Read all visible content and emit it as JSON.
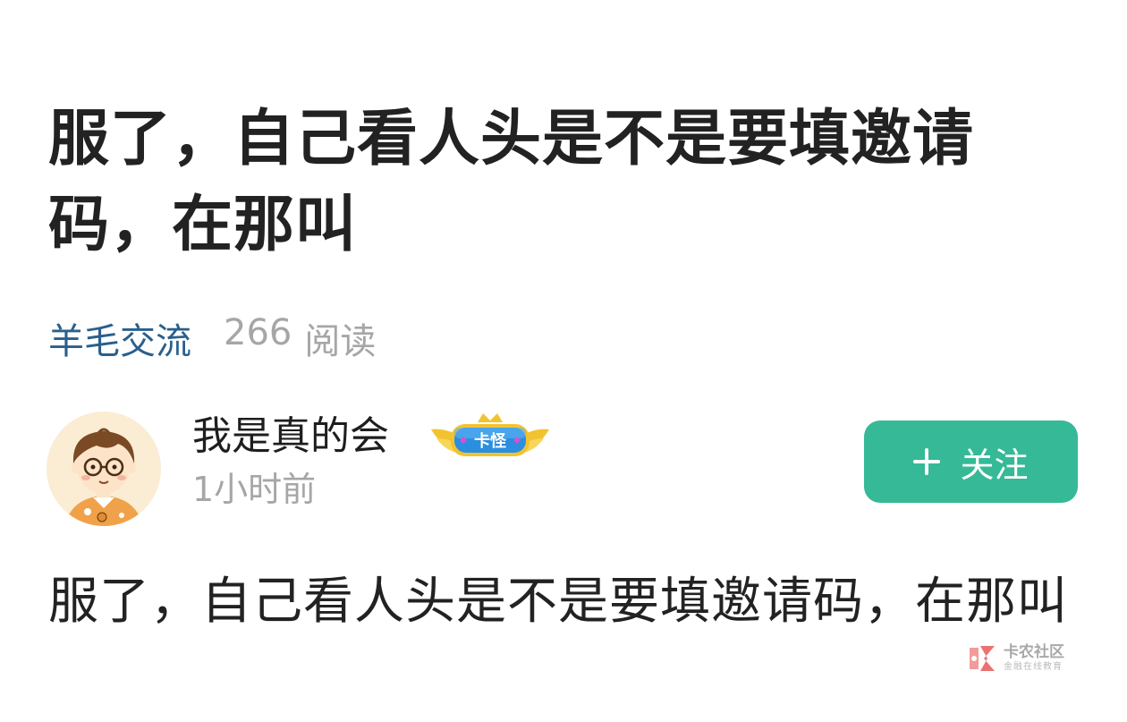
{
  "post": {
    "title": "服了，自己看人头是不是要填邀请码，在那叫",
    "category": "羊毛交流",
    "read_count": "266",
    "read_label": "阅读",
    "body": "服了，自己看人头是不是要填邀请码，在那叫"
  },
  "author": {
    "name": "我是真的会",
    "badge_text": "卡怪",
    "time": "1小时前",
    "avatar_icon": "cartoon-boy-avatar"
  },
  "actions": {
    "follow_label": "关注",
    "follow_icon": "plus-icon"
  },
  "watermark": {
    "name": "卡农社区",
    "slogan": "金融在线教育"
  },
  "colors": {
    "accent": "#35b996",
    "category": "#2a5f8c",
    "muted": "#a6a6a6",
    "text": "#222222"
  }
}
